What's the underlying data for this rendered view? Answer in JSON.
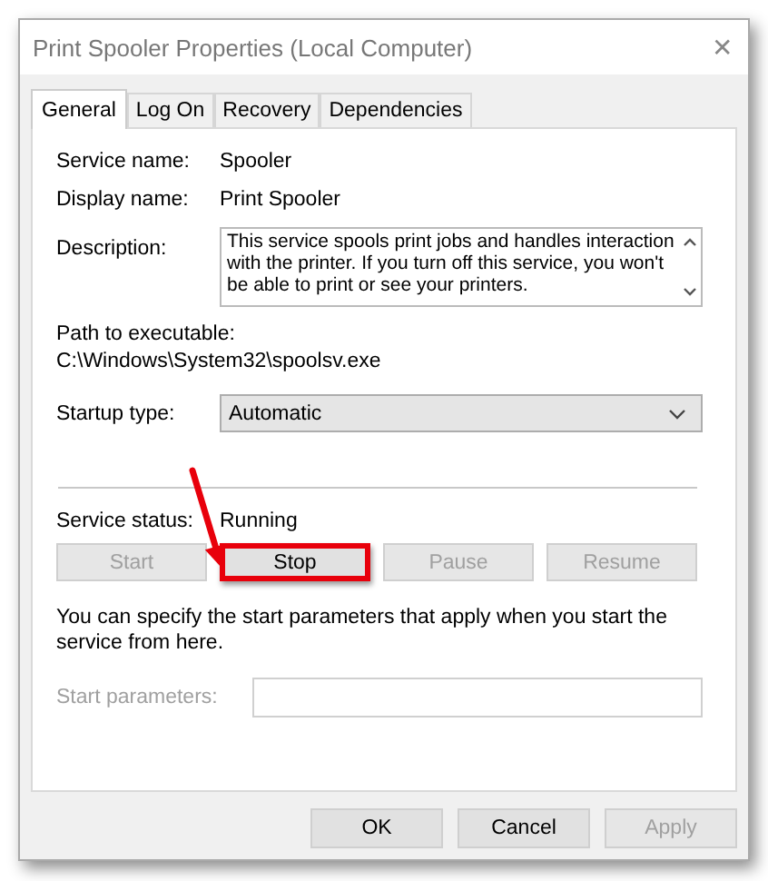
{
  "window": {
    "title": "Print Spooler Properties (Local Computer)",
    "close_glyph": "✕"
  },
  "tabs": [
    {
      "label": "General",
      "selected": true
    },
    {
      "label": "Log On",
      "selected": false
    },
    {
      "label": "Recovery",
      "selected": false
    },
    {
      "label": "Dependencies",
      "selected": false
    }
  ],
  "fields": [
    {
      "label": "Service name:",
      "value": "Spooler"
    },
    {
      "label": "Display name:",
      "value": "Print Spooler"
    }
  ],
  "description": {
    "label": "Description:",
    "value": "This service spools print jobs and handles interaction with the printer.  If you turn off this service, you won't be able to print or see your printers."
  },
  "path": {
    "label": "Path to executable:",
    "value": "C:\\Windows\\System32\\spoolsv.exe"
  },
  "startup": {
    "label": "Startup type:",
    "value": "Automatic"
  },
  "status": {
    "label": "Service status:",
    "value": "Running"
  },
  "service_buttons": [
    {
      "label": "Start",
      "disabled": true,
      "highlighted": false
    },
    {
      "label": "Stop",
      "disabled": false,
      "highlighted": true
    },
    {
      "label": "Pause",
      "disabled": true,
      "highlighted": false
    },
    {
      "label": "Resume",
      "disabled": true,
      "highlighted": false
    }
  ],
  "hint": "You can specify the start parameters that apply when you start the service from here.",
  "start_parameters": {
    "label": "Start parameters:",
    "disabled": true
  },
  "dialog_buttons": [
    {
      "label": "OK",
      "disabled": false
    },
    {
      "label": "Cancel",
      "disabled": false
    },
    {
      "label": "Apply",
      "disabled": true
    }
  ]
}
